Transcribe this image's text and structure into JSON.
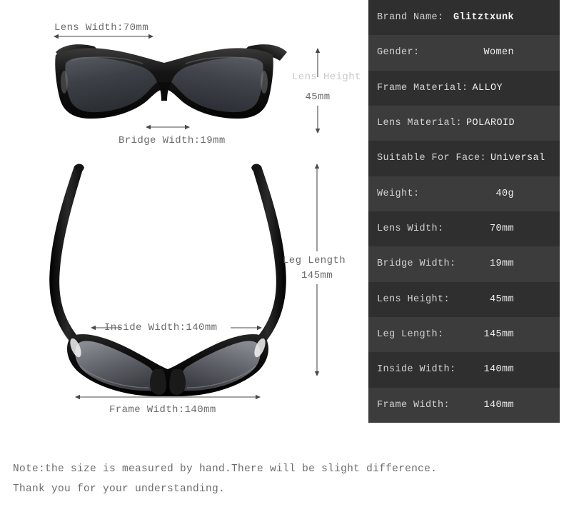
{
  "spec_table": {
    "rows": [
      {
        "label": "Brand Name:",
        "value": "Glitztxunk",
        "style": "gap"
      },
      {
        "label": "Gender:",
        "value": "Women",
        "style": "gap"
      },
      {
        "label": "Frame Material:",
        "value": "ALLOY",
        "style": "tight"
      },
      {
        "label": "Lens Material:",
        "value": "POLAROID",
        "style": "tight"
      },
      {
        "label": "Suitable For Face:",
        "value": "Universal",
        "style": "tight"
      },
      {
        "label": "Weight:",
        "value": "40g",
        "style": "gap"
      },
      {
        "label": "Lens Width:",
        "value": "70mm",
        "style": "gap"
      },
      {
        "label": "Bridge Width:",
        "value": "19mm",
        "style": "gap"
      },
      {
        "label": "Lens Height:",
        "value": "45mm",
        "style": "gap"
      },
      {
        "label": "Leg Length:",
        "value": "145mm",
        "style": "gap"
      },
      {
        "label": "Inside Width:",
        "value": "140mm",
        "style": "gap"
      },
      {
        "label": "Frame Width:",
        "value": "140mm",
        "style": "gap"
      }
    ],
    "row_color_odd": "#2f2f2f",
    "row_color_even": "#3c3c3c",
    "label_color": "#d2d2d2",
    "value_color": "#ededed"
  },
  "diagram_front": {
    "lens_width_label": "Lens Width:70mm",
    "bridge_width_label": "Bridge Width:19mm",
    "lens_height_label": "Lens Height",
    "lens_height_value": "45mm"
  },
  "diagram_top": {
    "leg_length_label": "Leg Length",
    "leg_length_value": "145mm",
    "inside_width_label": "Inside Width:140mm",
    "frame_width_label": "Frame Width:140mm"
  },
  "note": {
    "line1": "Note:the size is measured by hand.There will be slight difference.",
    "line2": "Thank you for your understanding."
  }
}
